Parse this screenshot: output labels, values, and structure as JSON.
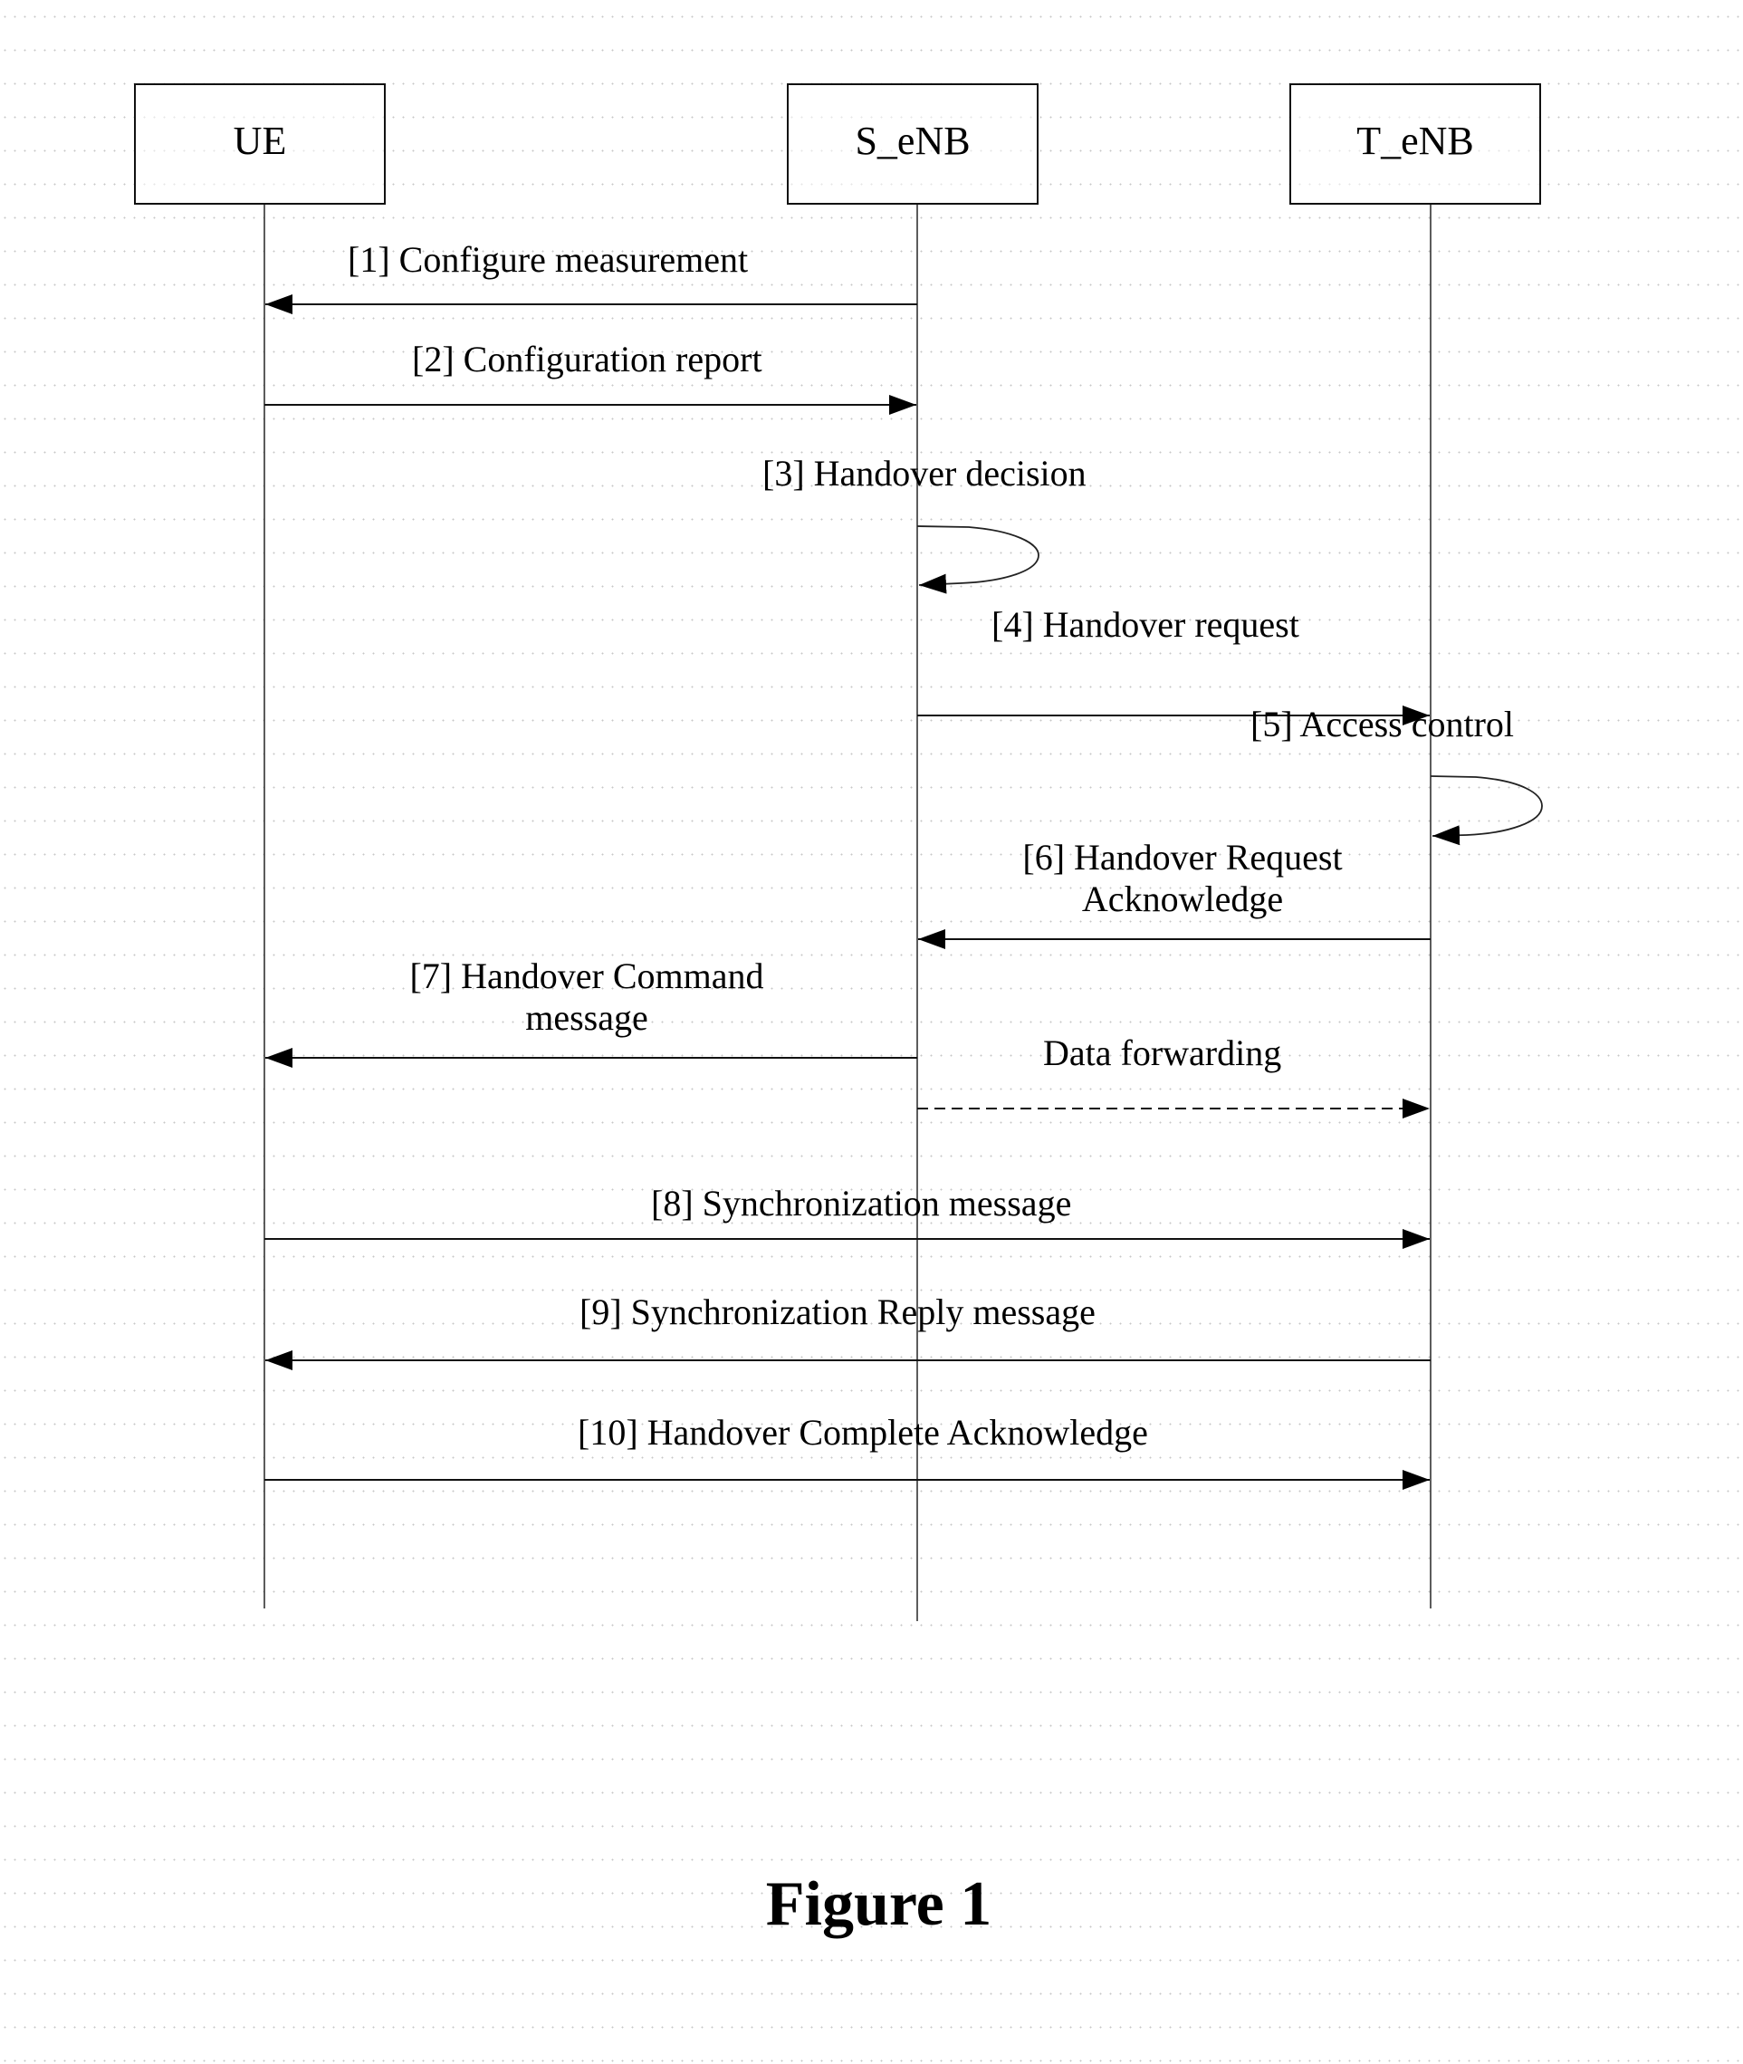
{
  "diagram_type": "sequence",
  "actors": [
    {
      "id": "ue",
      "label": "UE"
    },
    {
      "id": "s_enb",
      "label": "S_eNB"
    },
    {
      "id": "t_enb",
      "label": "T_eNB"
    }
  ],
  "messages": [
    {
      "step": "[1]",
      "label": "[1] Configure measurement",
      "lines": [
        "[1] Configure measurement"
      ],
      "from": "s_enb",
      "to": "ue",
      "style": "solid"
    },
    {
      "step": "[2]",
      "label": "[2] Configuration report",
      "lines": [
        "[2] Configuration report"
      ],
      "from": "ue",
      "to": "s_enb",
      "style": "solid"
    },
    {
      "step": "[3]",
      "label": "[3] Handover decision",
      "lines": [
        "[3] Handover decision"
      ],
      "from": "s_enb",
      "to": "s_enb",
      "style": "self-loop"
    },
    {
      "step": "[4]",
      "label": "[4] Handover request",
      "lines": [
        "[4] Handover request"
      ],
      "from": "s_enb",
      "to": "t_enb",
      "style": "solid"
    },
    {
      "step": "[5]",
      "label": "[5] Access control",
      "lines": [
        "[5] Access control"
      ],
      "from": "t_enb",
      "to": "t_enb",
      "style": "self-loop"
    },
    {
      "step": "[6]",
      "label": "[6] Handover Request Acknowledge",
      "lines": [
        "[6] Handover Request",
        "Acknowledge"
      ],
      "from": "t_enb",
      "to": "s_enb",
      "style": "solid"
    },
    {
      "step": "[7]",
      "label": "[7] Handover Command message",
      "lines": [
        "[7] Handover Command",
        "message"
      ],
      "from": "s_enb",
      "to": "ue",
      "style": "solid"
    },
    {
      "step": "",
      "label": "Data forwarding",
      "lines": [
        "Data forwarding"
      ],
      "from": "s_enb",
      "to": "t_enb",
      "style": "dashed"
    },
    {
      "step": "[8]",
      "label": "[8] Synchronization message",
      "lines": [
        "[8] Synchronization message"
      ],
      "from": "ue",
      "to": "t_enb",
      "style": "solid"
    },
    {
      "step": "[9]",
      "label": "[9] Synchronization Reply message",
      "lines": [
        "[9] Synchronization Reply message"
      ],
      "from": "t_enb",
      "to": "ue",
      "style": "solid"
    },
    {
      "step": "[10]",
      "label": "[10] Handover Complete Acknowledge",
      "lines": [
        "[10] Handover Complete Acknowledge"
      ],
      "from": "ue",
      "to": "t_enb",
      "style": "solid"
    }
  ],
  "caption": "Figure 1",
  "colors": {
    "ink": "#000000",
    "background": "#ffffff"
  }
}
